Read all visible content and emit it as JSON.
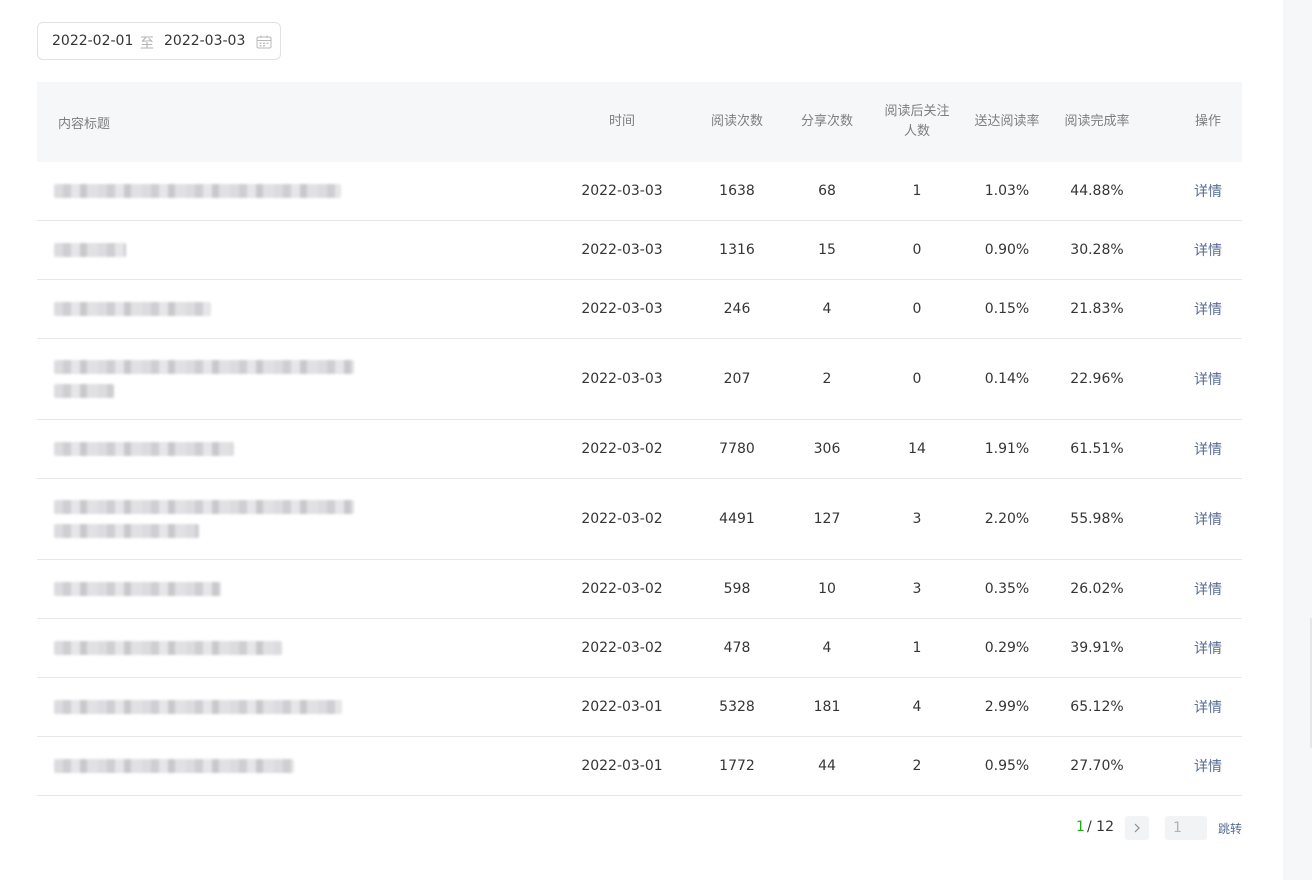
{
  "date_range": {
    "start": "2022-02-01",
    "separator": "至",
    "end": "2022-03-03",
    "icon": "calendar-icon"
  },
  "table": {
    "columns": {
      "title": "内容标题",
      "time": "时间",
      "reads": "阅读次数",
      "shares": "分享次数",
      "follows": "阅读后关注人数",
      "reach_rate": "送达阅读率",
      "completion_rate": "阅读完成率",
      "action": "操作"
    },
    "rows": [
      {
        "time": "2022-03-03",
        "reads": "1638",
        "shares": "68",
        "follows": "1",
        "reach_rate": "1.03%",
        "completion_rate": "44.88%",
        "action": "详情"
      },
      {
        "time": "2022-03-03",
        "reads": "1316",
        "shares": "15",
        "follows": "0",
        "reach_rate": "0.90%",
        "completion_rate": "30.28%",
        "action": "详情"
      },
      {
        "time": "2022-03-03",
        "reads": "246",
        "shares": "4",
        "follows": "0",
        "reach_rate": "0.15%",
        "completion_rate": "21.83%",
        "action": "详情"
      },
      {
        "time": "2022-03-03",
        "reads": "207",
        "shares": "2",
        "follows": "0",
        "reach_rate": "0.14%",
        "completion_rate": "22.96%",
        "action": "详情"
      },
      {
        "time": "2022-03-02",
        "reads": "7780",
        "shares": "306",
        "follows": "14",
        "reach_rate": "1.91%",
        "completion_rate": "61.51%",
        "action": "详情"
      },
      {
        "time": "2022-03-02",
        "reads": "4491",
        "shares": "127",
        "follows": "3",
        "reach_rate": "2.20%",
        "completion_rate": "55.98%",
        "action": "详情"
      },
      {
        "time": "2022-03-02",
        "reads": "598",
        "shares": "10",
        "follows": "3",
        "reach_rate": "0.35%",
        "completion_rate": "26.02%",
        "action": "详情"
      },
      {
        "time": "2022-03-02",
        "reads": "478",
        "shares": "4",
        "follows": "1",
        "reach_rate": "0.29%",
        "completion_rate": "39.91%",
        "action": "详情"
      },
      {
        "time": "2022-03-01",
        "reads": "5328",
        "shares": "181",
        "follows": "4",
        "reach_rate": "2.99%",
        "completion_rate": "65.12%",
        "action": "详情"
      },
      {
        "time": "2022-03-01",
        "reads": "1772",
        "shares": "44",
        "follows": "2",
        "reach_rate": "0.95%",
        "completion_rate": "27.70%",
        "action": "详情"
      }
    ]
  },
  "pagination": {
    "current": "1",
    "total": "/ 12",
    "next_icon": "chevron-right-icon",
    "jump_placeholder": "1",
    "jump_label": "跳转"
  }
}
